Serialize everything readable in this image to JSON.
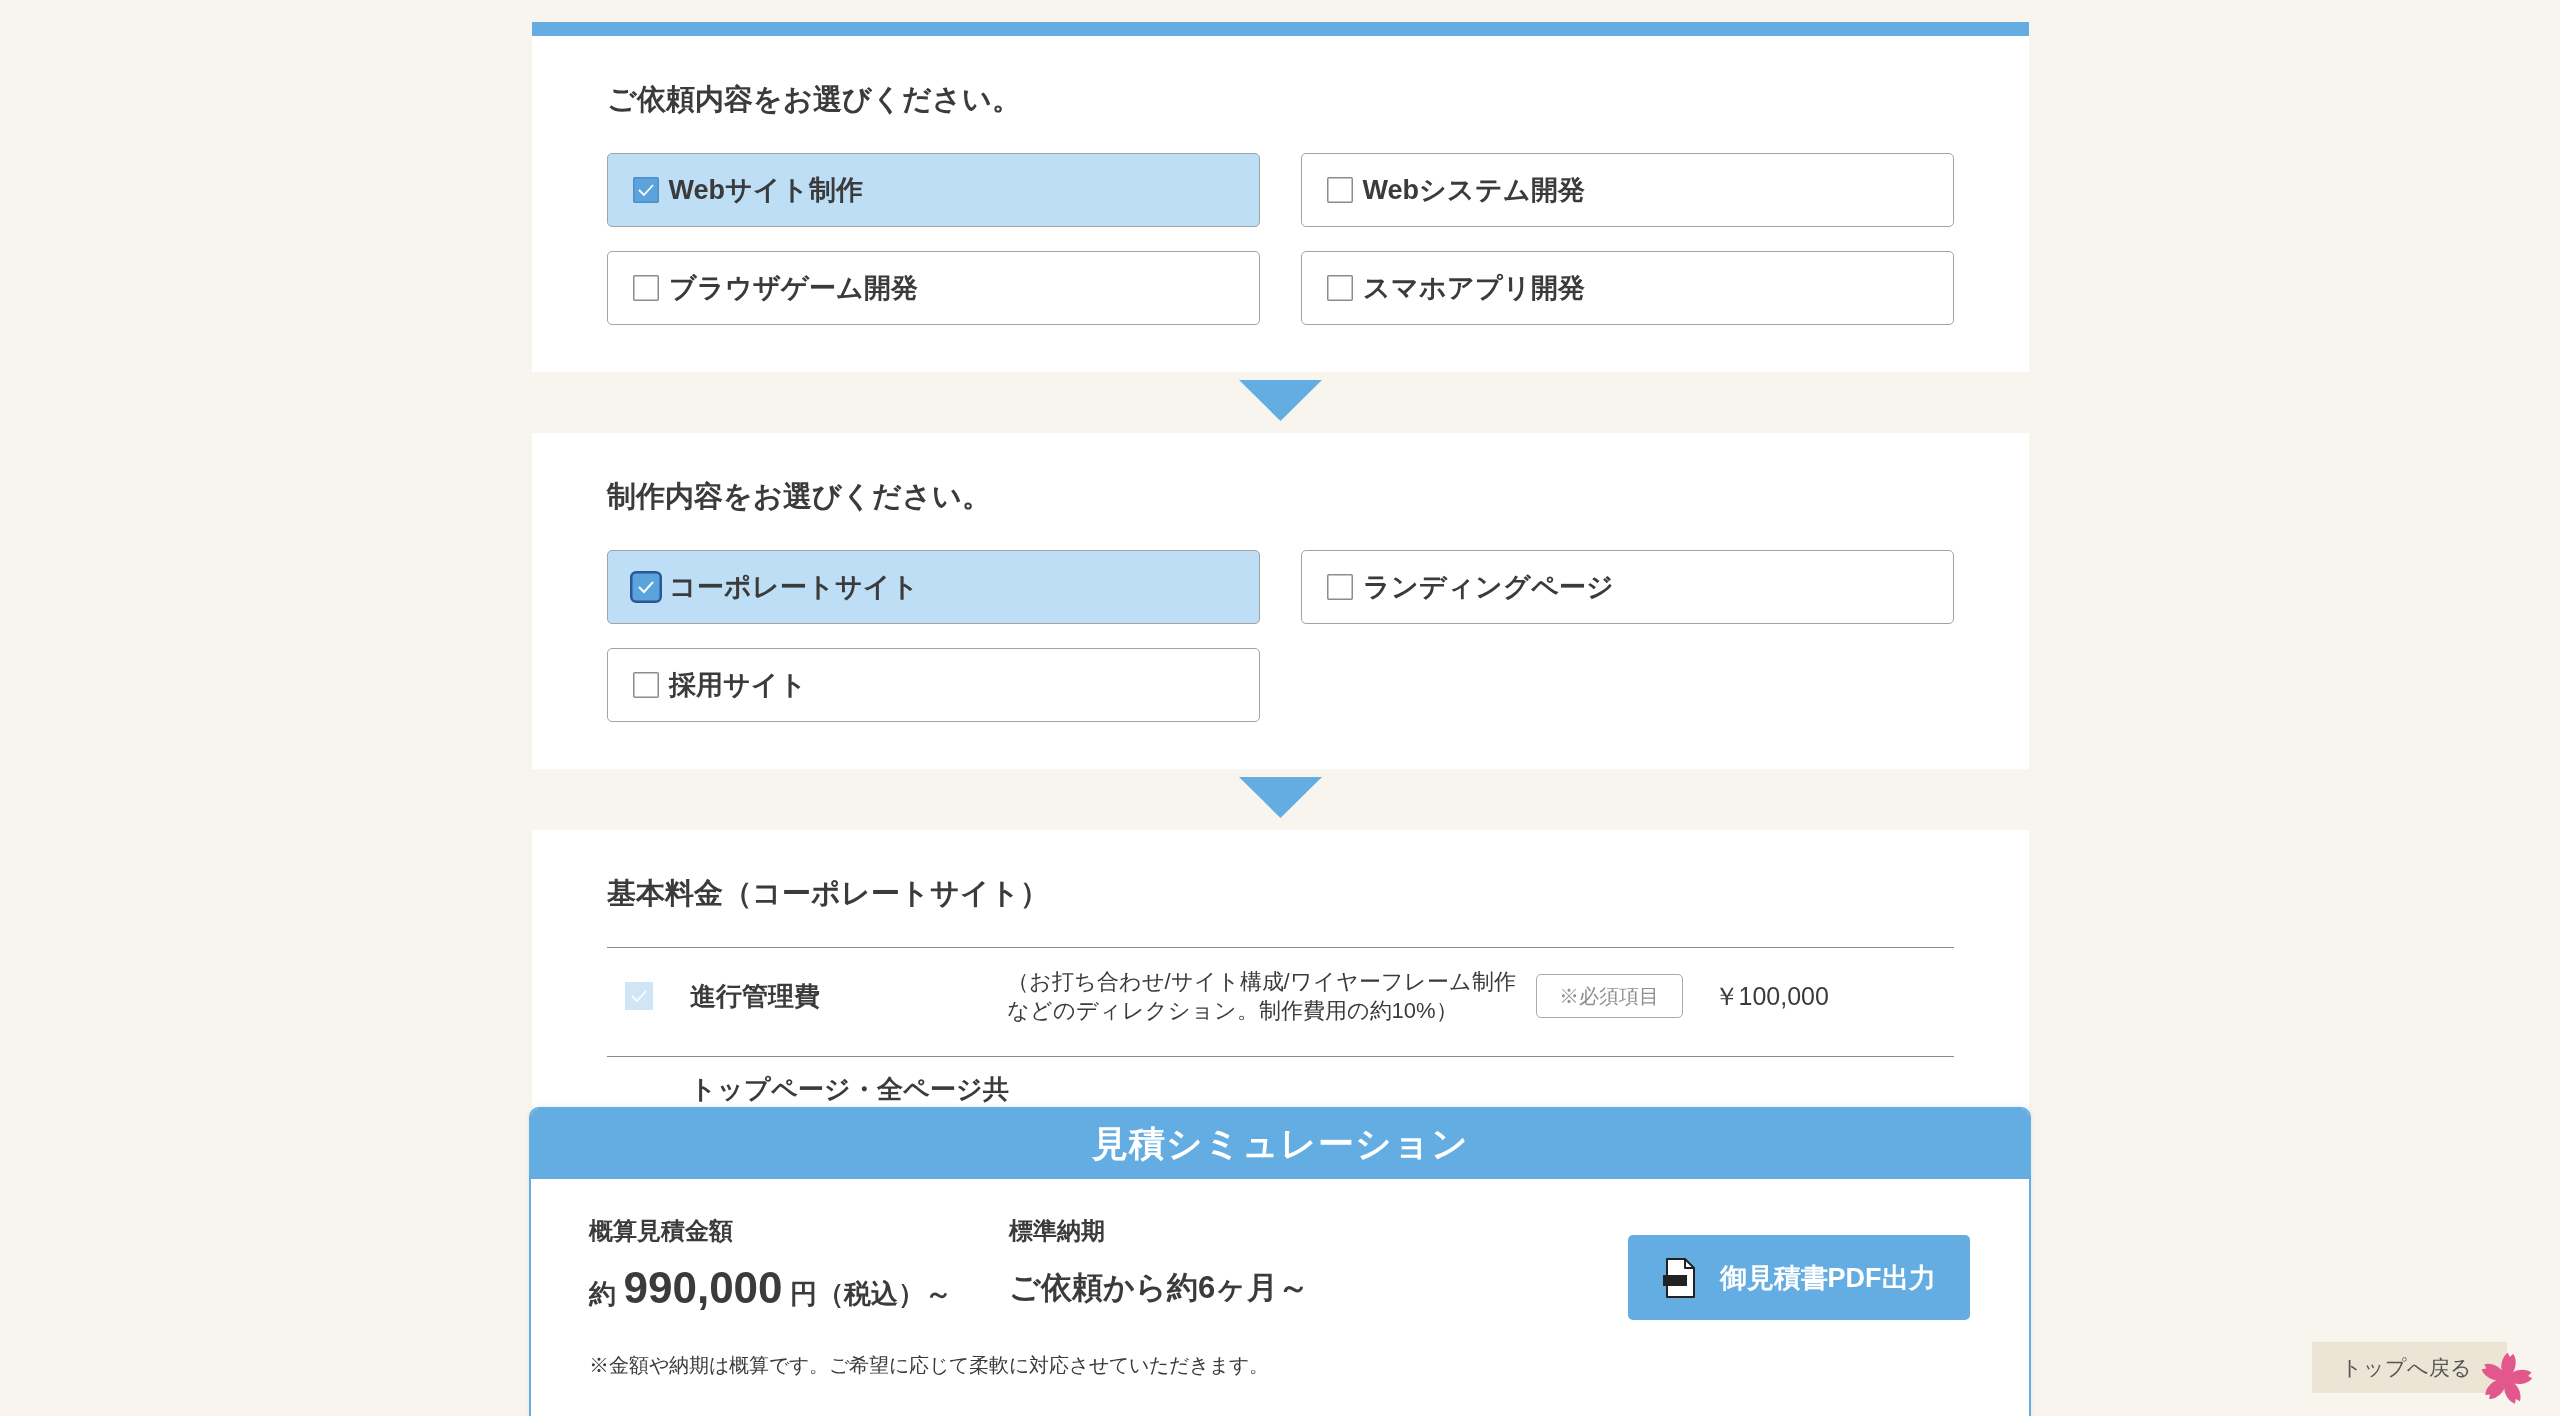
{
  "sections": [
    {
      "kind": "choice",
      "heading": "ご依頼内容をお選びください。",
      "options": [
        {
          "label": "Webサイト制作",
          "checked": true,
          "focused": false
        },
        {
          "label": "Webシステム開発",
          "checked": false,
          "focused": false
        },
        {
          "label": "ブラウザゲーム開発",
          "checked": false,
          "focused": false
        },
        {
          "label": "スマホアプリ開発",
          "checked": false,
          "focused": false
        }
      ]
    },
    {
      "kind": "choice",
      "heading": "制作内容をお選びください。",
      "options": [
        {
          "label": "コーポレートサイト",
          "checked": true,
          "focused": true
        },
        {
          "label": "ランディングページ",
          "checked": false,
          "focused": false
        },
        {
          "label": "採用サイト",
          "checked": false,
          "focused": false
        }
      ]
    },
    {
      "kind": "price_table",
      "heading": "基本料金（コーポレートサイト）",
      "rows": [
        {
          "name": "進行管理費",
          "description": "（お打ち合わせ/サイト構成/ワイヤーフレーム制作などのディレクション。制作費用の約10%）",
          "badge": "※必須項目",
          "price": "￥100,000",
          "checked": true,
          "disabled": true
        },
        {
          "name": "トップページ・全ページ共"
        }
      ]
    }
  ],
  "estimate": {
    "title": "見積シミュレーション",
    "amount_label": "概算見積金額",
    "amount_prefix": "約",
    "amount": "990,000",
    "amount_unit": "円",
    "amount_suffix": "（税込）～",
    "delivery_label": "標準納期",
    "delivery": "ご依頼から約6ヶ月～",
    "note": "※金額や納期は概算です。ご希望に応じて柔軟に対応させていただきます。",
    "pdf_button": "御見積書PDF出力"
  },
  "back_to_top": "トップへ戻る"
}
